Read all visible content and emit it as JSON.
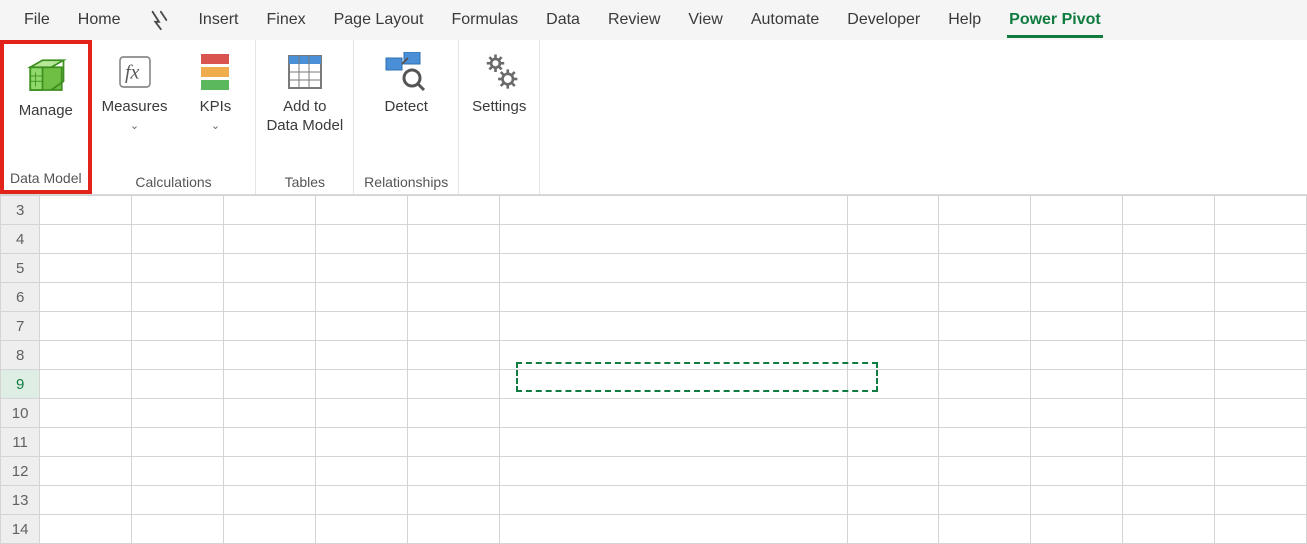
{
  "tabs": {
    "file": "File",
    "home": "Home",
    "insert": "Insert",
    "finex": "Finex",
    "page_layout": "Page Layout",
    "formulas": "Formulas",
    "data": "Data",
    "review": "Review",
    "view": "View",
    "automate": "Automate",
    "developer": "Developer",
    "help": "Help",
    "power_pivot": "Power Pivot"
  },
  "ribbon": {
    "data_model": {
      "manage": "Manage",
      "group_label": "Data Model"
    },
    "calculations": {
      "measures": "Measures",
      "kpis": "KPIs",
      "group_label": "Calculations"
    },
    "tables": {
      "add_to_data_model": "Add to\nData Model",
      "group_label": "Tables"
    },
    "relationships": {
      "detect": "Detect",
      "group_label": "Relationships"
    },
    "settings": {
      "settings": "Settings"
    }
  },
  "sheet": {
    "visible_rows": [
      "3",
      "4",
      "5",
      "6",
      "7",
      "8",
      "9",
      "10",
      "11",
      "12",
      "13",
      "14"
    ],
    "selected_row": "9",
    "marquee": {
      "top_row": "9",
      "col_start": "F",
      "col_end": "F"
    }
  },
  "colors": {
    "accent": "#0f7b3f",
    "highlight": "#e2231a"
  }
}
